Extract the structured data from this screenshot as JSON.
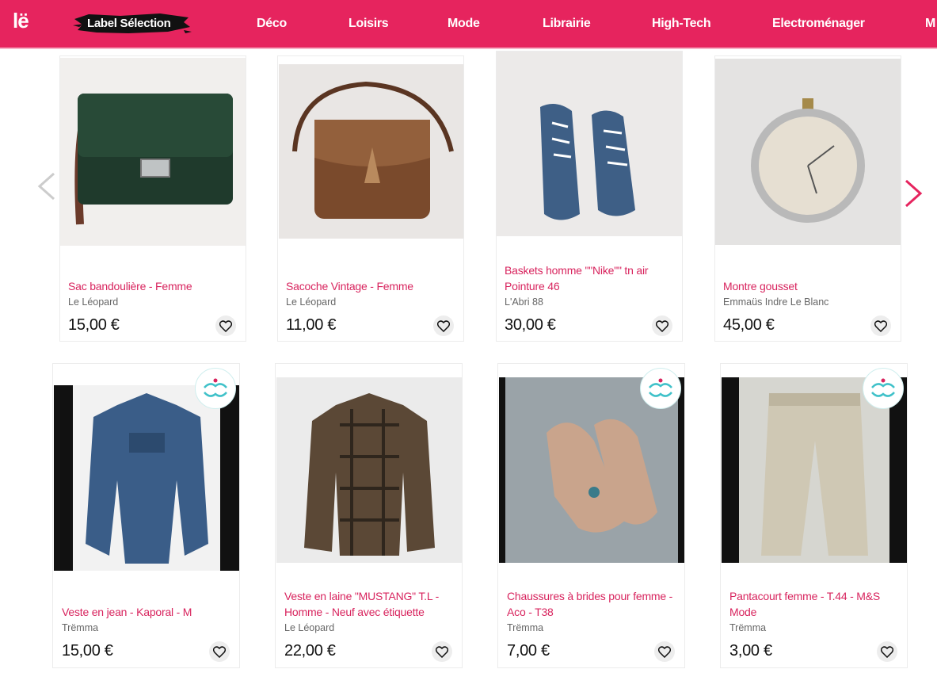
{
  "header": {
    "logo": "lë",
    "label_selection": "Label Sélection",
    "nav": [
      "Déco",
      "Loisirs",
      "Mode",
      "Librairie",
      "High-Tech",
      "Electroménager",
      "M"
    ]
  },
  "colors": {
    "brand": "#e6245e",
    "title": "#d8245e",
    "badge": "#3fc1c9"
  },
  "products": [
    {
      "title": "Sac bandoulière - Femme",
      "shop": "Le Léopard",
      "price": "15,00 €"
    },
    {
      "title": "Sacoche Vintage - Femme",
      "shop": "Le Léopard",
      "price": "11,00 €"
    },
    {
      "title": "Baskets homme \"\"Nike\"\" tn air Pointure 46",
      "shop": "L'Abri 88",
      "price": "30,00 €"
    },
    {
      "title": "Montre gousset",
      "shop": "Emmaüs Indre Le Blanc",
      "price": "45,00 €"
    },
    {
      "title": "Veste en jean - Kaporal - M",
      "shop": "Trëmma",
      "price": "15,00 €"
    },
    {
      "title": "Veste en laine \"MUSTANG\" T.L - Homme - Neuf avec étiquette",
      "shop": "Le Léopard",
      "price": "22,00 €"
    },
    {
      "title": "Chaussures à brides pour femme - Aco - T38",
      "shop": "Trëmma",
      "price": "7,00 €"
    },
    {
      "title": "Pantacourt femme - T.44 - M&S Mode",
      "shop": "Trëmma",
      "price": "3,00 €"
    }
  ]
}
